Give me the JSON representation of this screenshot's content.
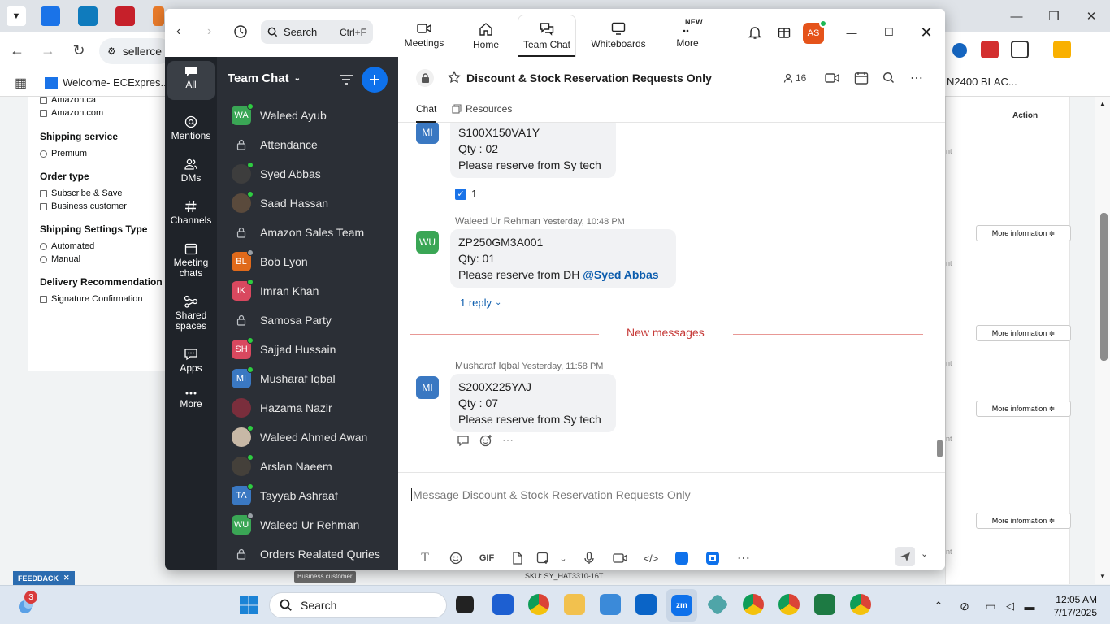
{
  "browser": {
    "address_fragment": "sellerce",
    "bookmark": "Welcome- ECExpres...",
    "right_page_fragment": "N2400 BLAC..."
  },
  "page": {
    "filters": {
      "top_partial": [
        {
          "label": "Amazon.ca"
        },
        {
          "label": "Amazon.com"
        }
      ],
      "groups": [
        {
          "title": "Shipping service",
          "kind": "radio",
          "options": [
            "Premium"
          ]
        },
        {
          "title": "Order type",
          "kind": "checkbox",
          "options": [
            "Subscribe & Save",
            "Business customer"
          ]
        },
        {
          "title": "Shipping Settings Type",
          "kind": "radio",
          "options": [
            "Automated",
            "Manual"
          ]
        },
        {
          "title": "Delivery Recommendation",
          "kind": "checkbox",
          "options": [
            "Signature Confirmation"
          ]
        }
      ]
    },
    "table": {
      "action_header": "Action",
      "more_info_label": "More information ≑",
      "fragment_text": "nt"
    },
    "tooltip": "Business customer",
    "sku_text": "SKU: SY_HAT3310-16T",
    "feedback_label": "FEEDBACK"
  },
  "zoom": {
    "search": {
      "label": "Search",
      "shortcut": "Ctrl+F"
    },
    "tabs": [
      {
        "label": "Meetings",
        "icon": "video-camera-icon"
      },
      {
        "label": "Home",
        "icon": "home-icon"
      },
      {
        "label": "Team Chat",
        "icon": "chat-bubbles-icon",
        "active": true
      },
      {
        "label": "Whiteboards",
        "icon": "whiteboard-icon"
      },
      {
        "label": "More",
        "icon": "more-dots-icon",
        "badge": "NEW"
      }
    ],
    "user_initials": "AS",
    "rail": [
      {
        "label": "All",
        "icon": "chat-icon",
        "active": true
      },
      {
        "label": "Mentions",
        "icon": "at-icon"
      },
      {
        "label": "DMs",
        "icon": "people-icon"
      },
      {
        "label": "Channels",
        "icon": "hash-icon"
      },
      {
        "label": "Meeting chats",
        "icon": "calendar-icon"
      },
      {
        "label": "Shared spaces",
        "icon": "shared-icon"
      },
      {
        "label": "Apps",
        "icon": "apps-icon"
      },
      {
        "label": "More",
        "icon": "more-icon"
      }
    ],
    "list_title": "Team Chat",
    "chats": [
      {
        "name": "Waleed Ayub",
        "type": "avatar",
        "initials": "WA",
        "color": "#3aa655",
        "status": "online"
      },
      {
        "name": "Attendance",
        "type": "lock"
      },
      {
        "name": "Syed Abbas",
        "type": "photo",
        "color": "#3d3d3d",
        "status": "online"
      },
      {
        "name": "Saad Hassan",
        "type": "photo",
        "color": "#5a4a3c",
        "status": "online"
      },
      {
        "name": "Amazon Sales Team",
        "type": "lock"
      },
      {
        "name": "Bob Lyon",
        "type": "avatar",
        "initials": "BL",
        "color": "#e06a1b",
        "status": "away"
      },
      {
        "name": "Imran Khan",
        "type": "avatar",
        "initials": "IK",
        "color": "#d9485f",
        "status": "online"
      },
      {
        "name": "Samosa Party",
        "type": "lock"
      },
      {
        "name": "Sajjad Hussain",
        "type": "avatar",
        "initials": "SH",
        "color": "#d9485f",
        "status": "online"
      },
      {
        "name": "Musharaf Iqbal",
        "type": "avatar",
        "initials": "MI",
        "color": "#3a78c2",
        "status": "online"
      },
      {
        "name": "Hazama Nazir",
        "type": "photo",
        "color": "#7a2e3c",
        "status": "none"
      },
      {
        "name": "Waleed Ahmed Awan",
        "type": "photo",
        "color": "#c7b8a6",
        "status": "online"
      },
      {
        "name": "Arslan Naeem",
        "type": "photo",
        "color": "#44403a",
        "status": "online"
      },
      {
        "name": "Tayyab Ashraaf",
        "type": "avatar",
        "initials": "TA",
        "color": "#3a78c2",
        "status": "online"
      },
      {
        "name": "Waleed Ur Rehman",
        "type": "avatar",
        "initials": "WU",
        "color": "#3aa655",
        "status": "away"
      },
      {
        "name": "Orders Realated Quries",
        "type": "lock"
      }
    ],
    "channel": {
      "title": "Discount & Stock Reservation Requests Only",
      "member_count": "16",
      "tabs": [
        "Chat",
        "Resources"
      ]
    },
    "messages": [
      {
        "initials": "MI",
        "color": "#3a78c2",
        "lines": [
          "S100X150VA1Y",
          "Qty : 02",
          "Please reserve from Sy tech"
        ],
        "reaction": "☑",
        "reaction_count": "1"
      },
      {
        "initials": "WU",
        "color": "#3aa655",
        "sender": "Waleed Ur Rehman",
        "time": "Yesterday, 10:48 PM",
        "lines": [
          "ZP250GM3A001",
          "Qty: 01",
          "Please reserve from DH "
        ],
        "mention": "@Syed Abbas",
        "replies": "1 reply"
      },
      {
        "initials": "MI",
        "color": "#3a78c2",
        "sender": "Musharaf Iqbal",
        "time": "Yesterday, 11:58 PM",
        "lines": [
          "S200X225YAJ",
          "Qty : 07",
          "Please reserve from Sy tech"
        ]
      }
    ],
    "new_messages_label": "New messages",
    "composer_placeholder": "Message Discount & Stock Reservation Requests Only",
    "composer_gif": "GIF"
  },
  "taskbar": {
    "search_label": "Search",
    "widget_badge": "3",
    "time": "12:05 AM",
    "date": "7/17/2025"
  }
}
